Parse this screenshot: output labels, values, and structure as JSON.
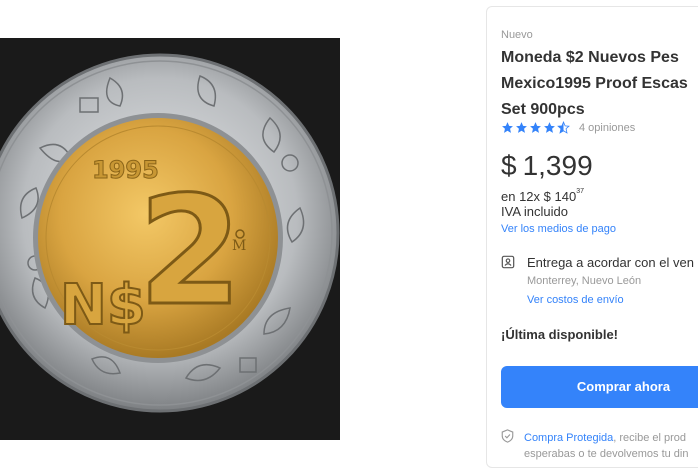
{
  "product": {
    "condition": "Nuevo",
    "title_lines": [
      "Moneda $2 Nuevos Pes",
      "Mexico1995 Proof Escas",
      "Set 900pcs"
    ],
    "rating": 4.5,
    "reviews": "4 opiniones",
    "price_currency": "$",
    "price_value": "1,399",
    "installments_text": "en 12x $ 140",
    "installments_cents": "37",
    "iva": "IVA incluido",
    "payment_link": "Ver los medios de pago"
  },
  "delivery": {
    "icon": "person-card-icon",
    "title": "Entrega a acordar con el ven",
    "location": "Monterrey, Nuevo León",
    "shipping_link": "Ver costos de envío"
  },
  "stock": "¡Última disponible!",
  "buy_button": "Comprar ahora",
  "protection": {
    "icon": "shield-check-icon",
    "link": "Compra Protegida",
    "line1_rest": ", recibe el prod",
    "line2": "esperabas o te devolvemos tu din"
  },
  "coin_image": {
    "year": "1995",
    "denomination": "2",
    "symbol": "N$",
    "mint_mark": "M",
    "colors": {
      "inner": "#d9a441",
      "ring": "#b9bcbf",
      "background": "#1a1a1a"
    }
  },
  "colors": {
    "accent": "#3483fa",
    "text": "#333333",
    "muted": "#999999"
  }
}
